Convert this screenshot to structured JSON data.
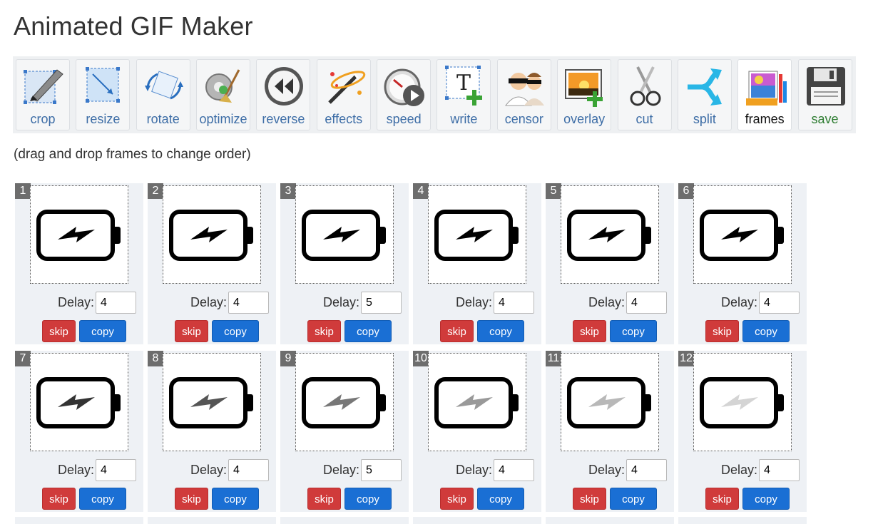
{
  "page": {
    "title": "Animated GIF Maker",
    "hint": "(drag and drop frames to change order)"
  },
  "toolbar": {
    "items": [
      {
        "label": "crop",
        "icon": "crop-icon"
      },
      {
        "label": "resize",
        "icon": "resize-icon"
      },
      {
        "label": "rotate",
        "icon": "rotate-icon"
      },
      {
        "label": "optimize",
        "icon": "optimize-icon"
      },
      {
        "label": "reverse",
        "icon": "reverse-icon"
      },
      {
        "label": "effects",
        "icon": "effects-icon"
      },
      {
        "label": "speed",
        "icon": "speed-icon"
      },
      {
        "label": "write",
        "icon": "write-icon"
      },
      {
        "label": "censor",
        "icon": "censor-icon"
      },
      {
        "label": "overlay",
        "icon": "overlay-icon"
      },
      {
        "label": "cut",
        "icon": "cut-icon"
      },
      {
        "label": "split",
        "icon": "split-icon"
      },
      {
        "label": "frames",
        "icon": "frames-icon",
        "active": true
      },
      {
        "label": "save",
        "icon": "save-icon"
      }
    ]
  },
  "frame_labels": {
    "delay": "Delay:",
    "skip": "skip",
    "copy": "copy"
  },
  "frames": [
    {
      "number": "1",
      "delay": "4",
      "bolt_color": "#000000"
    },
    {
      "number": "2",
      "delay": "4",
      "bolt_color": "#000000"
    },
    {
      "number": "3",
      "delay": "5",
      "bolt_color": "#000000"
    },
    {
      "number": "4",
      "delay": "4",
      "bolt_color": "#000000"
    },
    {
      "number": "5",
      "delay": "4",
      "bolt_color": "#000000"
    },
    {
      "number": "6",
      "delay": "4",
      "bolt_color": "#000000"
    },
    {
      "number": "7",
      "delay": "4",
      "bolt_color": "#333333"
    },
    {
      "number": "8",
      "delay": "4",
      "bolt_color": "#555555"
    },
    {
      "number": "9",
      "delay": "5",
      "bolt_color": "#777777"
    },
    {
      "number": "10",
      "delay": "4",
      "bolt_color": "#999999"
    },
    {
      "number": "11",
      "delay": "4",
      "bolt_color": "#b8b8b8"
    },
    {
      "number": "12",
      "delay": "4",
      "bolt_color": "#d4d4d4"
    }
  ],
  "colors": {
    "skip": "#d03b3b",
    "copy": "#1a6fd4",
    "frame_bg": "#eef1f5",
    "badge": "#6d6d6d"
  }
}
